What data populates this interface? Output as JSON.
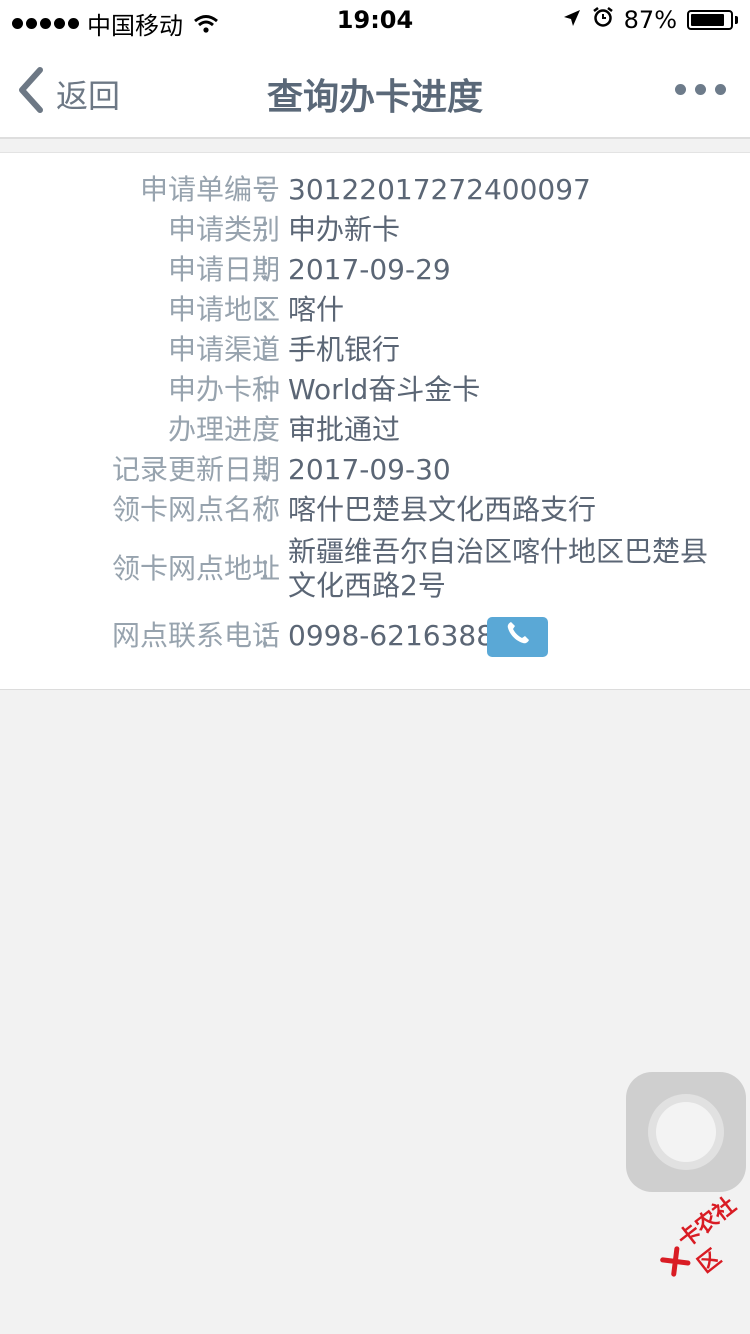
{
  "status_bar": {
    "carrier": "中国移动",
    "time": "19:04",
    "battery": "87%",
    "battery_level": 0.87
  },
  "nav": {
    "back_label": "返回",
    "title": "查询办卡进度"
  },
  "details": [
    {
      "label": "申请单编号",
      "value": "30122017272400097"
    },
    {
      "label": "申请类别",
      "value": "申办新卡"
    },
    {
      "label": "申请日期",
      "value": "2017-09-29"
    },
    {
      "label": "申请地区",
      "value": "喀什"
    },
    {
      "label": "申请渠道",
      "value": "手机银行"
    },
    {
      "label": "申办卡种",
      "value": "World奋斗金卡"
    },
    {
      "label": "办理进度",
      "value": "审批通过"
    },
    {
      "label": "记录更新日期",
      "value": "2017-09-30"
    },
    {
      "label": "领卡网点名称",
      "value": "喀什巴楚县文化西路支行"
    },
    {
      "label": "领卡网点地址",
      "value": "新疆维吾尔自治区喀什地区巴楚县文化西路2号"
    },
    {
      "label": "网点联系电话",
      "value": "0998-6216388"
    }
  ],
  "colon": "：",
  "watermark": "卡农社区",
  "colors": {
    "accent_call": "#5aa8d6",
    "label": "#97a3ae",
    "value": "#5b6675",
    "watermark": "#d91c24"
  },
  "icons": {
    "back": "chevron-left-icon",
    "more": "more-dots-icon",
    "call": "phone-icon",
    "location": "location-arrow-icon",
    "alarm": "alarm-icon",
    "wifi": "wifi-icon"
  }
}
